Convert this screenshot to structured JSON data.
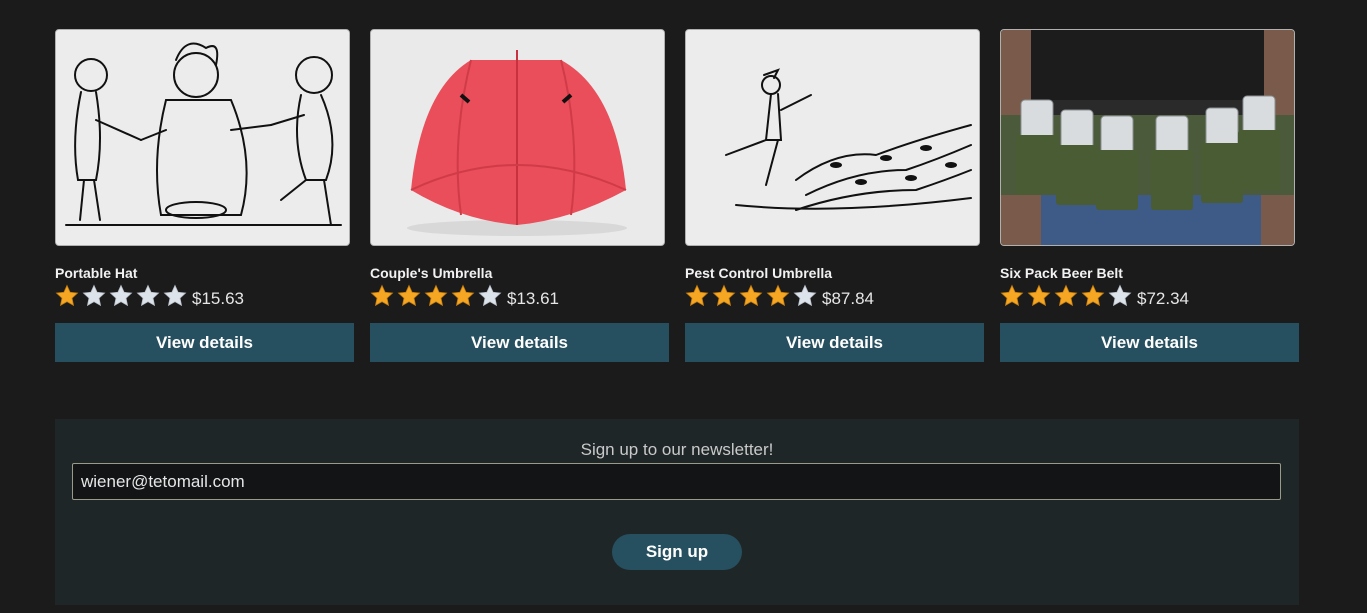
{
  "products": [
    {
      "name": "Portable Hat",
      "rating": 1,
      "max_rating": 5,
      "price": "$15.63",
      "button": "View details",
      "image_icon": "cartoon-people-drawing"
    },
    {
      "name": "Couple's Umbrella",
      "rating": 4,
      "max_rating": 5,
      "price": "$13.61",
      "button": "View details",
      "image_icon": "red-umbrella"
    },
    {
      "name": "Pest Control Umbrella",
      "rating": 4,
      "max_rating": 5,
      "price": "$87.84",
      "button": "View details",
      "image_icon": "pied-piper-sketch"
    },
    {
      "name": "Six Pack Beer Belt",
      "rating": 4,
      "max_rating": 5,
      "price": "$72.34",
      "button": "View details",
      "image_icon": "beer-belt-photo"
    }
  ],
  "newsletter": {
    "title": "Sign up to our newsletter!",
    "email_value": "wiener@tetomail.com",
    "button": "Sign up"
  },
  "colors": {
    "background": "#1b1b1b",
    "button": "#26505f",
    "star_filled": "#f5a623",
    "star_empty": "#dde3ea",
    "newsletter_bg": "#1f2628"
  }
}
